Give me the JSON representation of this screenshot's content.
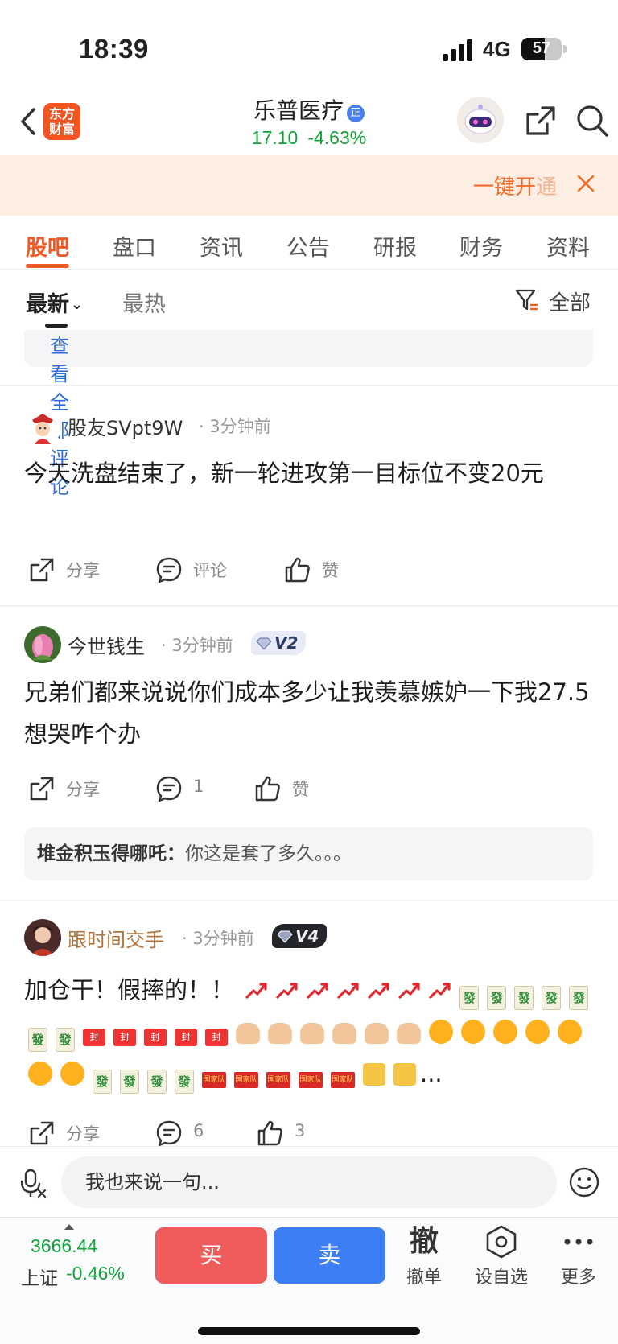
{
  "status_bar": {
    "time": "18:39",
    "network": "4G",
    "battery": "57",
    "battery_level": 0.57
  },
  "header": {
    "stock_name": "乐普医疗",
    "verified_badge": "正",
    "price": "17.10",
    "change_pct": "-4.63%",
    "brand_logo": "东方财富",
    "icons": [
      "back-arrow-icon",
      "robot-avatar",
      "share-icon",
      "search-icon"
    ]
  },
  "promo": {
    "text": "一键开通"
  },
  "tabs": [
    "股吧",
    "盘口",
    "资讯",
    "公告",
    "研报",
    "财务",
    "资料"
  ],
  "sort": {
    "latest": "最新",
    "hot": "最热",
    "filter": "全部"
  },
  "view_all": {
    "label": "查看全部评论"
  },
  "posts": [
    {
      "user": "股友SVpt9W",
      "time": "3分钟前",
      "content": "今天洗盘结束了，新一轮进攻第一目标位不变20元",
      "actions": {
        "share": "分享",
        "comment": "评论",
        "like": "赞"
      }
    },
    {
      "user": "今世钱生",
      "time": "3分钟前",
      "level": "V2",
      "content": "兄弟们都来说说你们成本多少让我羡慕嫉妒一下我27.5想哭咋个办",
      "actions": {
        "share": "分享",
        "comment": "1",
        "like": "赞"
      },
      "reply": {
        "user": "堆金积玉得哪吒：",
        "text": "你这是套了多久。。。"
      }
    },
    {
      "user": "跟时间交手",
      "time": "3分钟前",
      "level": "V4",
      "content": "加仓干！假摔的！！",
      "content_more": "...",
      "emoji_labels": {
        "mahjong": "發",
        "red_packet": "封",
        "flag": "国家队"
      },
      "actions": {
        "share": "分享",
        "comment": "6",
        "like": "3"
      }
    }
  ],
  "input": {
    "placeholder": "我也来说一句..."
  },
  "tradebar": {
    "index_value": "3666.44",
    "index_name": "上证",
    "index_change": "-0.46%",
    "buy": "买",
    "sell": "卖",
    "cancel_icon_char": "撤",
    "cancel_label": "撤单",
    "watchlist_label": "设自选",
    "more_label": "更多"
  },
  "colors": {
    "accent": "#ef5a24",
    "down_green": "#14a33a",
    "buy_red": "#ef5b5b",
    "sell_blue": "#3d7ef5",
    "link_blue": "#2f6bd8"
  }
}
